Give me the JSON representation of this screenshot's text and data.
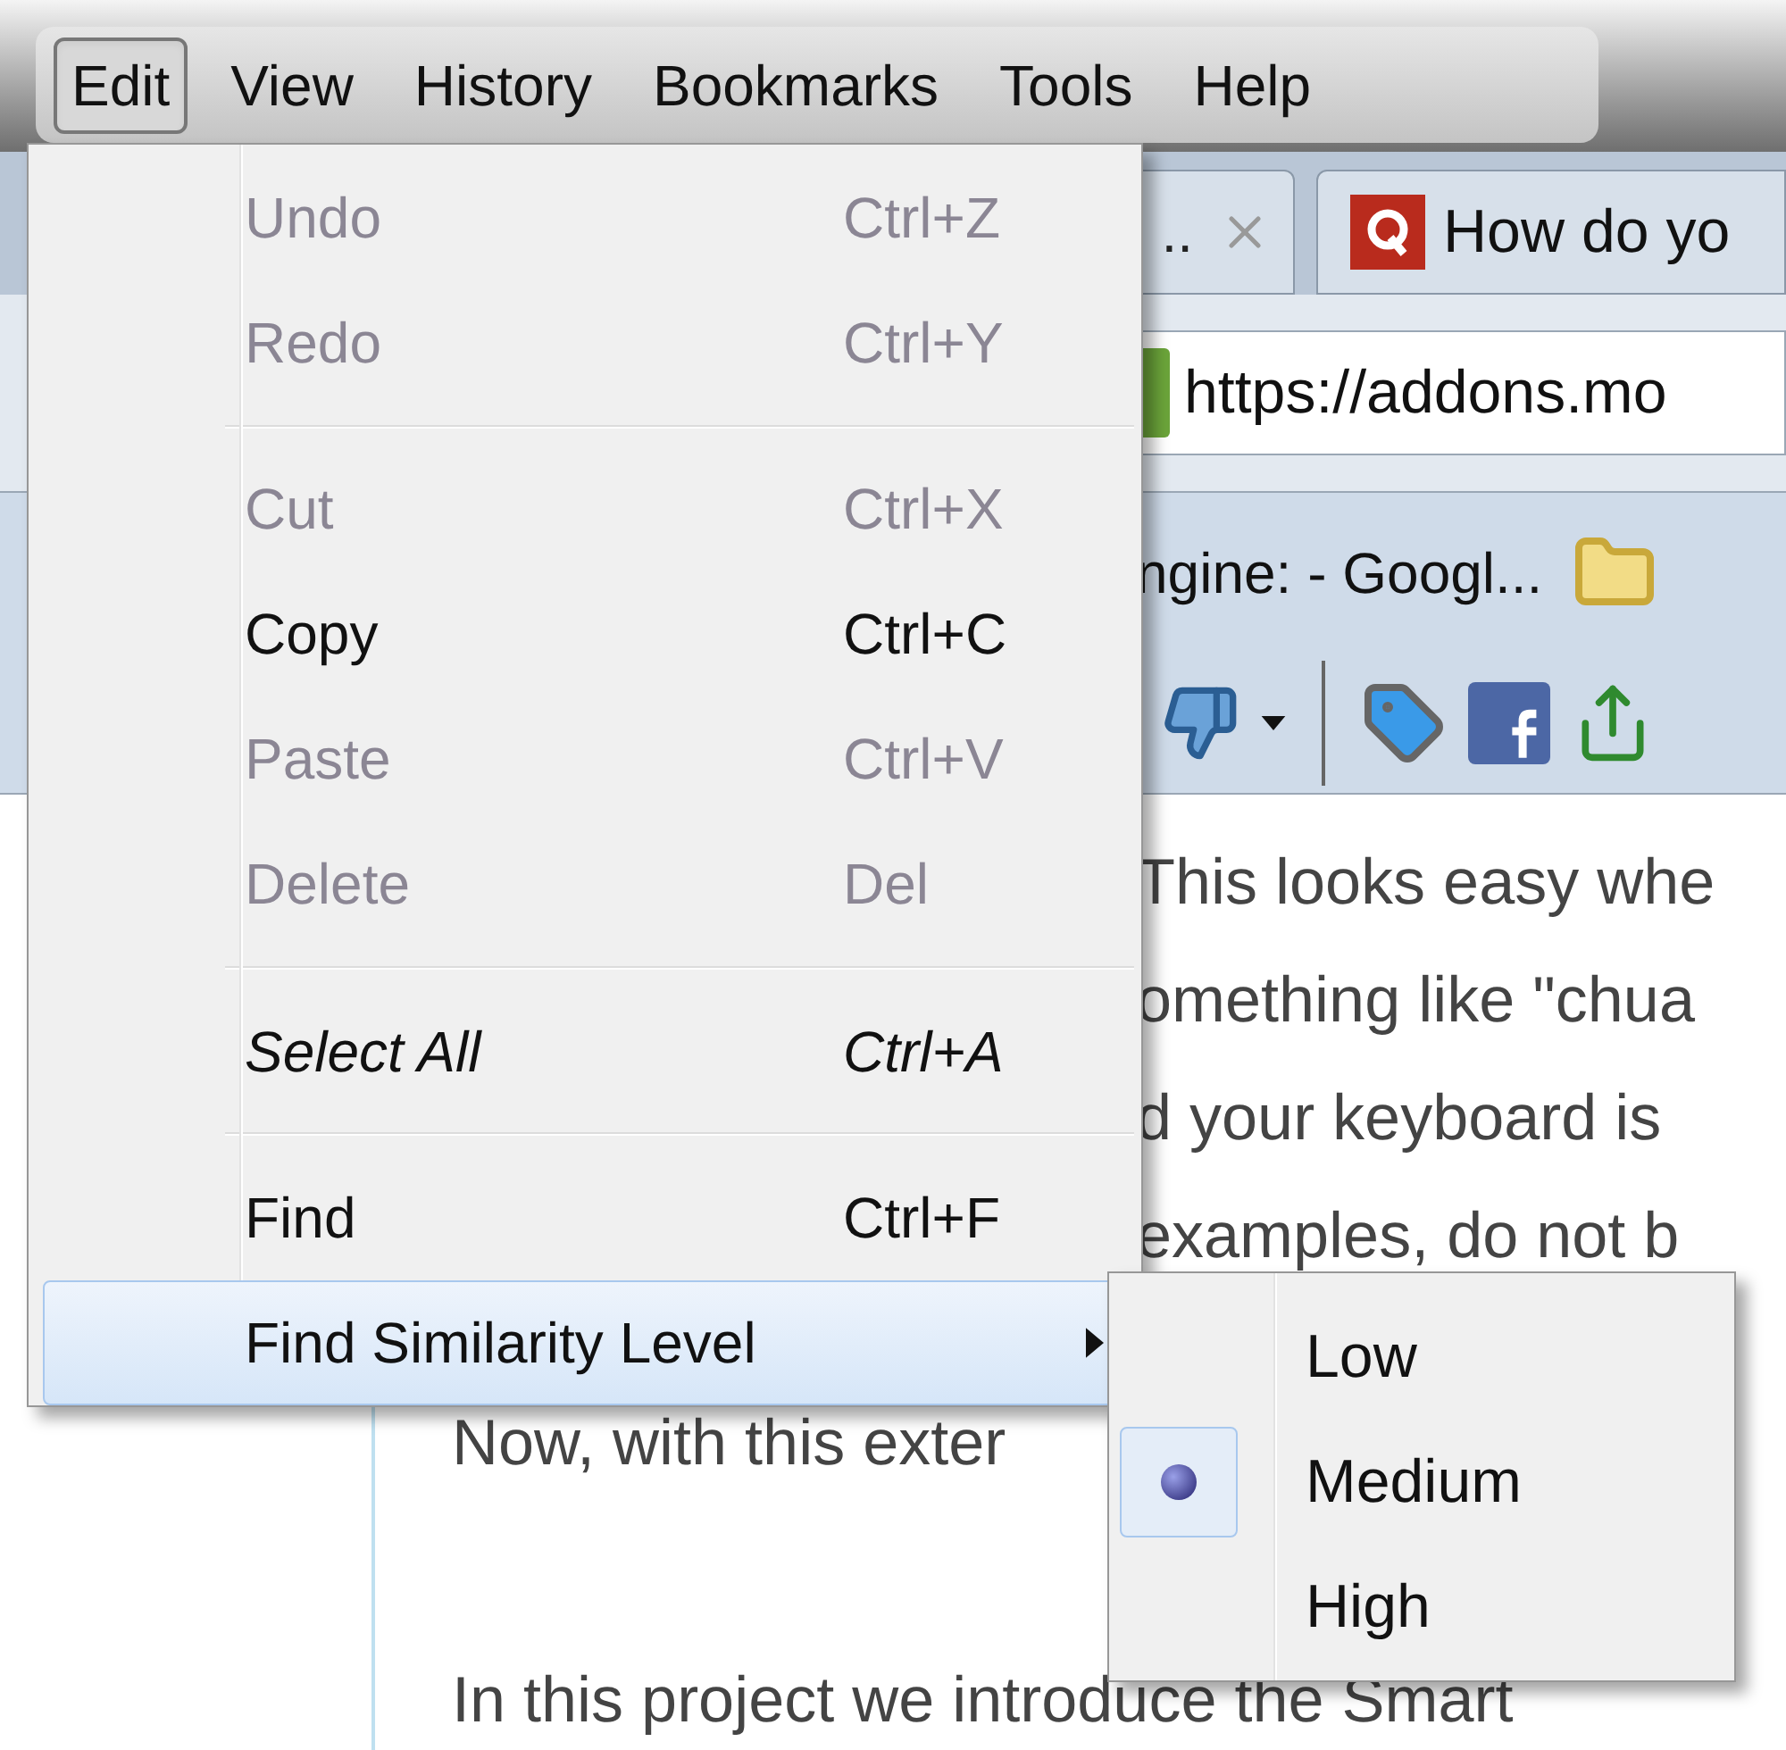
{
  "menu_bar": [
    {
      "label": "Edit",
      "selected": true
    },
    {
      "label": "View",
      "selected": false
    },
    {
      "label": "History",
      "selected": false
    },
    {
      "label": "Bookmarks",
      "selected": false
    },
    {
      "label": "Tools",
      "selected": false
    },
    {
      "label": "Help",
      "selected": false
    }
  ],
  "browser": {
    "tabs": [
      {
        "label": ".."
      },
      {
        "label": "How do yo"
      }
    ],
    "url": "https://addons.mo",
    "bookmark": "ngine: - Googl...",
    "content_beside_menu": [
      "This looks easy whe",
      "omething like \"chua",
      "d your keyboard is",
      "examples, do not b"
    ],
    "content_below_menu": [
      "Now, with this exter",
      "In this project we introduce the Smart"
    ]
  },
  "edit_menu": {
    "items": [
      {
        "kind": "item",
        "label": "Undo",
        "shortcut": "Ctrl+Z",
        "disabled": true,
        "emphasized": false,
        "highlighted": false
      },
      {
        "kind": "item",
        "label": "Redo",
        "shortcut": "Ctrl+Y",
        "disabled": true,
        "emphasized": false,
        "highlighted": false
      },
      {
        "kind": "separator"
      },
      {
        "kind": "item",
        "label": "Cut",
        "shortcut": "Ctrl+X",
        "disabled": true,
        "emphasized": false,
        "highlighted": false
      },
      {
        "kind": "item",
        "label": "Copy",
        "shortcut": "Ctrl+C",
        "disabled": false,
        "emphasized": false,
        "highlighted": false
      },
      {
        "kind": "item",
        "label": "Paste",
        "shortcut": "Ctrl+V",
        "disabled": true,
        "emphasized": false,
        "highlighted": false
      },
      {
        "kind": "item",
        "label": "Delete",
        "shortcut": "Del",
        "disabled": true,
        "emphasized": false,
        "highlighted": false
      },
      {
        "kind": "separator"
      },
      {
        "kind": "item",
        "label": "Select All",
        "shortcut": "Ctrl+A",
        "disabled": false,
        "emphasized": true,
        "highlighted": false
      },
      {
        "kind": "separator"
      },
      {
        "kind": "item",
        "label": "Find",
        "shortcut": "Ctrl+F",
        "disabled": false,
        "emphasized": false,
        "highlighted": false
      },
      {
        "kind": "submenu",
        "label": "Find Similarity Level",
        "disabled": false,
        "emphasized": false,
        "highlighted": true
      }
    ]
  },
  "submenu": {
    "items": [
      {
        "label": "Low",
        "selected": false
      },
      {
        "label": "Medium",
        "selected": true
      },
      {
        "label": "High",
        "selected": false
      }
    ]
  }
}
